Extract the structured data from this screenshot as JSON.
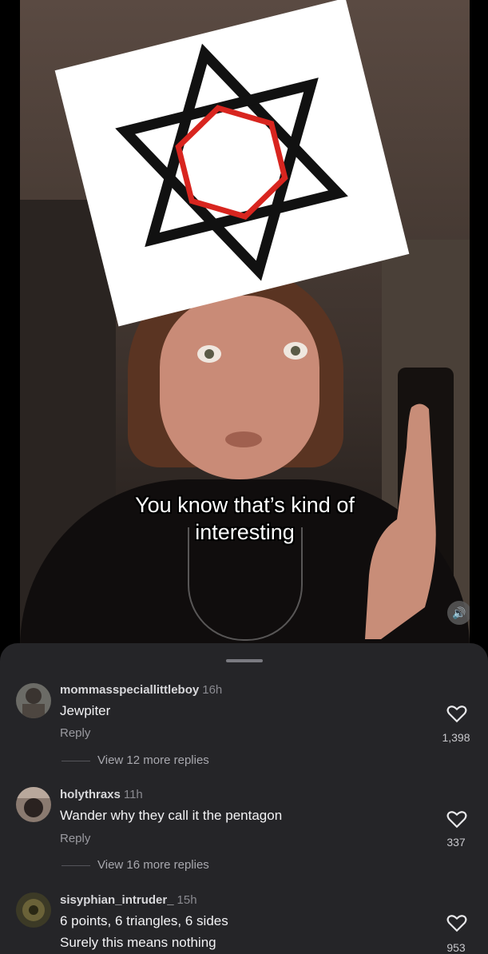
{
  "video": {
    "caption_line1": "You know that’s kind of",
    "caption_line2": "interesting",
    "mute_icon": "speaker-icon"
  },
  "comments": [
    {
      "username": "mommasspeciallittleboy",
      "time": "16h",
      "text": "Jewpiter",
      "reply_label": "Reply",
      "likes": "1,398",
      "view_more": "View 12 more replies"
    },
    {
      "username": "holythraxs",
      "time": "11h",
      "text": "Wander why they call it the pentagon",
      "reply_label": "Reply",
      "likes": "337",
      "view_more": "View 16 more replies"
    },
    {
      "username": "sisyphian_intruder_",
      "time": "15h",
      "text_line1": "6 points, 6 triangles, 6 sides",
      "text_line2": "Surely this means nothing",
      "likes": "953"
    }
  ],
  "colors": {
    "sheet_bg": "#252528",
    "star": "#111111",
    "hexagon": "#d8251f"
  }
}
